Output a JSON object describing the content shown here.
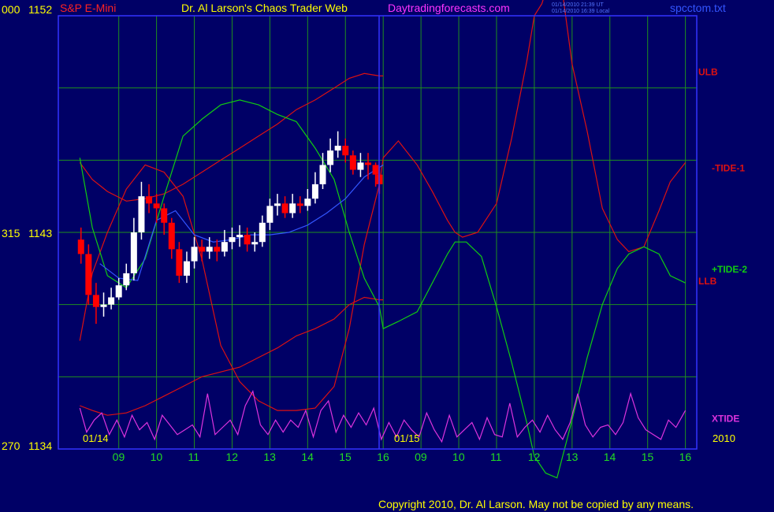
{
  "header": {
    "left_label": "000",
    "instrument": "S&P E-Mini",
    "title": "Dr. Al Larson's Chaos Trader Web",
    "site": "Daytradingforecasts.com",
    "timestamp_ut": "01/14/2010 21:39 UT",
    "timestamp_local": "01/14/2010 16:39 Local",
    "filename": "spcctom.txt"
  },
  "footer": {
    "copyright": "Copyright 2010, Dr. Al Larson. May not be copied by any means."
  },
  "chart_data": {
    "type": "line",
    "title": "S&P E-Mini",
    "ylim": [
      1134,
      1152
    ],
    "y_axis_left": [
      {
        "prefix": "000",
        "value": "1152"
      },
      {
        "prefix": "315",
        "value": "1143"
      },
      {
        "prefix": "270",
        "value": "1134"
      }
    ],
    "x_ticks": [
      "09",
      "10",
      "11",
      "12",
      "13",
      "14",
      "15",
      "16",
      "09",
      "10",
      "11",
      "12",
      "13",
      "14",
      "15",
      "16"
    ],
    "date_labels": [
      "01/14",
      "01/15"
    ],
    "year_label": "2010",
    "grid": true,
    "colors": {
      "background": "#000066",
      "grid": "#1f8f1f",
      "frame": "#3333ff",
      "ulb_llb": "#dd1111",
      "tide1": "#dd1111",
      "tide2": "#11cc11",
      "xtide": "#dd33dd",
      "price_up": "#ffffff",
      "price_down": "#ff0000",
      "avg": "#3355ff"
    },
    "series": [
      {
        "name": "ULB",
        "color": "#dd1111",
        "label_y": 1149.7,
        "x": [
          7.97,
          8.3,
          8.7,
          9.2,
          9.7,
          10.2,
          10.7,
          11.2,
          11.7,
          12.2,
          12.7,
          13.2,
          13.7,
          14.2,
          14.7,
          15.1,
          15.5,
          15.9,
          16.0
        ],
        "y": [
          1145.9,
          1145.2,
          1144.7,
          1144.3,
          1144.4,
          1144.6,
          1145.0,
          1145.5,
          1146.0,
          1146.5,
          1147.0,
          1147.5,
          1148.1,
          1148.5,
          1149.0,
          1149.4,
          1149.6,
          1149.5,
          1149.5
        ]
      },
      {
        "name": "LLB",
        "color": "#dd1111",
        "label_y": 1141.0,
        "x": [
          7.97,
          8.3,
          8.7,
          9.2,
          9.7,
          10.2,
          10.7,
          11.2,
          11.7,
          12.2,
          12.7,
          13.2,
          13.7,
          14.2,
          14.7,
          15.1,
          15.5,
          15.9,
          16.0
        ],
        "y": [
          1135.8,
          1135.6,
          1135.4,
          1135.5,
          1135.8,
          1136.2,
          1136.6,
          1137.0,
          1137.2,
          1137.4,
          1137.8,
          1138.2,
          1138.7,
          1139.0,
          1139.4,
          1140.0,
          1140.3,
          1140.2,
          1140.2
        ]
      },
      {
        "name": "-TIDE-1",
        "color": "#dd1111",
        "label_y": 1145.7,
        "x": [
          7.97,
          8.3,
          8.7,
          9.2,
          9.7,
          10.2,
          10.7,
          11.2,
          11.7,
          12.2,
          12.7,
          13.2,
          13.7,
          14.2,
          14.7,
          15.1,
          15.5,
          15.9,
          16.0,
          16.4,
          16.9,
          17.3,
          17.7,
          17.9,
          18.1,
          18.5,
          19.0,
          19.4,
          19.8,
          20.0,
          20.2,
          20.4,
          20.55,
          20.7,
          21.0,
          21.4,
          21.8,
          22.2,
          22.5,
          22.9,
          23.3,
          23.6,
          24.0
        ],
        "y": [
          1138.5,
          1141.3,
          1143.0,
          1144.8,
          1145.8,
          1145.5,
          1144.5,
          1141.9,
          1138.3,
          1136.8,
          1136.0,
          1135.6,
          1135.6,
          1135.7,
          1136.6,
          1139.0,
          1142.5,
          1145.0,
          1146.1,
          1146.8,
          1145.8,
          1144.7,
          1143.5,
          1143.0,
          1142.8,
          1143.0,
          1144.2,
          1146.9,
          1150.1,
          1152.0,
          1152.5,
          1153.5,
          1154.6,
          1153.5,
          1150.0,
          1147.2,
          1144.0,
          1142.7,
          1142.2,
          1142.4,
          1143.9,
          1145.1,
          1145.9
        ]
      },
      {
        "name": "+TIDE-2",
        "color": "#11cc11",
        "label_y": 1141.5,
        "x": [
          7.97,
          8.3,
          8.7,
          9.2,
          9.7,
          10.2,
          10.7,
          11.2,
          11.7,
          12.2,
          12.7,
          13.2,
          13.7,
          14.2,
          14.7,
          15.1,
          15.5,
          15.9,
          16.0,
          16.4,
          16.9,
          17.3,
          17.7,
          17.9,
          18.2,
          18.6,
          19.0,
          19.4,
          19.8,
          20.0,
          20.3,
          20.6,
          20.7,
          21.0,
          21.4,
          21.8,
          22.2,
          22.5,
          22.9,
          23.3,
          23.6,
          24.0
        ],
        "y": [
          1146.1,
          1143.2,
          1141.2,
          1140.7,
          1141.9,
          1144.5,
          1147.0,
          1147.7,
          1148.3,
          1148.5,
          1148.3,
          1147.9,
          1147.6,
          1146.5,
          1145.2,
          1143.0,
          1141.1,
          1139.9,
          1139.0,
          1139.3,
          1139.7,
          1140.9,
          1142.1,
          1142.6,
          1142.6,
          1142.0,
          1139.9,
          1137.6,
          1135.1,
          1133.7,
          1133.0,
          1132.8,
          1133.4,
          1135.2,
          1137.8,
          1140.0,
          1141.5,
          1142.1,
          1142.4,
          1142.1,
          1141.2,
          1140.9
        ]
      },
      {
        "name": "XTIDE",
        "color": "#dd33dd",
        "label_y": 1135.3,
        "x": [
          7.97,
          8.15,
          8.35,
          8.55,
          8.75,
          8.95,
          9.15,
          9.35,
          9.55,
          9.75,
          9.95,
          10.15,
          10.35,
          10.55,
          10.75,
          10.95,
          11.15,
          11.35,
          11.55,
          11.75,
          11.95,
          12.15,
          12.35,
          12.55,
          12.75,
          12.95,
          13.15,
          13.35,
          13.55,
          13.75,
          13.95,
          14.15,
          14.35,
          14.55,
          14.75,
          14.95,
          15.15,
          15.35,
          15.55,
          15.75,
          15.95,
          16.15,
          16.35,
          16.55,
          16.75,
          16.95,
          17.15,
          17.35,
          17.55,
          17.75,
          17.95,
          18.15,
          18.35,
          18.55,
          18.75,
          18.95,
          19.15,
          19.35,
          19.55,
          19.75,
          19.95,
          20.15,
          20.35,
          20.55,
          20.75,
          20.95,
          21.15,
          21.35,
          21.55,
          21.75,
          21.95,
          22.15,
          22.35,
          22.55,
          22.75,
          22.95,
          23.15,
          23.35,
          23.55,
          23.75,
          24.0
        ],
        "y": [
          1135.7,
          1134.7,
          1135.2,
          1135.5,
          1134.6,
          1135.2,
          1134.5,
          1135.4,
          1134.8,
          1135.1,
          1134.4,
          1135.4,
          1135.0,
          1134.6,
          1134.8,
          1135.0,
          1134.5,
          1136.3,
          1134.6,
          1134.9,
          1135.2,
          1134.6,
          1135.8,
          1136.4,
          1135.0,
          1134.6,
          1135.2,
          1134.7,
          1135.2,
          1134.9,
          1135.6,
          1134.5,
          1135.6,
          1136.0,
          1134.7,
          1135.4,
          1134.9,
          1135.5,
          1135.0,
          1135.7,
          1134.4,
          1135.1,
          1134.5,
          1135.2,
          1134.8,
          1134.5,
          1135.5,
          1134.8,
          1134.3,
          1135.4,
          1134.5,
          1134.8,
          1135.1,
          1134.4,
          1135.3,
          1134.6,
          1134.5,
          1135.9,
          1134.5,
          1134.9,
          1135.2,
          1134.7,
          1135.4,
          1134.8,
          1134.4,
          1135.1,
          1136.3,
          1135.0,
          1134.5,
          1134.9,
          1135.0,
          1134.6,
          1135.1,
          1136.3,
          1135.3,
          1134.8,
          1134.6,
          1134.4,
          1135.2,
          1134.9,
          1135.6
        ]
      },
      {
        "name": "avg",
        "color": "#3355ff",
        "x": [
          8.5,
          9.0,
          9.5,
          10.0,
          10.5,
          11.0,
          11.5,
          12.0,
          12.5,
          13.0,
          13.5,
          14.0,
          14.5,
          15.0,
          15.5,
          16.0
        ],
        "y": [
          1141.7,
          1141.1,
          1141.0,
          1143.5,
          1143.9,
          1142.9,
          1142.6,
          1142.7,
          1142.9,
          1142.9,
          1143.0,
          1143.3,
          1143.8,
          1144.4,
          1145.3,
          1145.8
        ]
      }
    ],
    "price": {
      "x": [
        8.0,
        8.2,
        8.4,
        8.6,
        8.8,
        9.0,
        9.2,
        9.4,
        9.6,
        9.8,
        10.0,
        10.2,
        10.4,
        10.6,
        10.8,
        11.0,
        11.2,
        11.4,
        11.6,
        11.8,
        12.0,
        12.2,
        12.4,
        12.6,
        12.8,
        13.0,
        13.2,
        13.4,
        13.6,
        13.8,
        14.0,
        14.2,
        14.4,
        14.6,
        14.8,
        15.0,
        15.2,
        15.4,
        15.6,
        15.8,
        15.9
      ],
      "open": [
        1142.7,
        1142.1,
        1140.4,
        1139.9,
        1140.0,
        1140.3,
        1140.8,
        1141.3,
        1143.0,
        1144.5,
        1144.2,
        1144.0,
        1143.4,
        1142.3,
        1141.2,
        1141.8,
        1142.4,
        1142.2,
        1142.4,
        1142.2,
        1142.6,
        1142.8,
        1142.9,
        1142.5,
        1142.6,
        1143.4,
        1144.1,
        1144.2,
        1143.8,
        1144.2,
        1144.1,
        1144.4,
        1145.0,
        1145.8,
        1146.4,
        1146.6,
        1146.2,
        1145.6,
        1145.9,
        1145.8,
        1145.4
      ],
      "close": [
        1142.1,
        1140.4,
        1139.9,
        1140.0,
        1140.3,
        1140.8,
        1141.3,
        1143.0,
        1144.5,
        1144.2,
        1144.0,
        1143.4,
        1142.3,
        1141.2,
        1141.8,
        1142.4,
        1142.2,
        1142.4,
        1142.2,
        1142.6,
        1142.8,
        1142.9,
        1142.5,
        1142.6,
        1143.4,
        1144.1,
        1144.2,
        1143.8,
        1144.2,
        1144.1,
        1144.4,
        1145.0,
        1145.8,
        1146.4,
        1146.6,
        1146.2,
        1145.6,
        1145.9,
        1145.8,
        1145.4,
        1145.0
      ],
      "high": [
        1143.2,
        1142.5,
        1140.9,
        1140.5,
        1140.7,
        1141.1,
        1141.7,
        1143.6,
        1145.1,
        1145.0,
        1144.6,
        1144.2,
        1143.6,
        1142.6,
        1142.2,
        1142.8,
        1142.7,
        1142.8,
        1142.7,
        1143.1,
        1143.2,
        1143.3,
        1143.2,
        1143.0,
        1143.7,
        1144.4,
        1144.6,
        1144.5,
        1144.6,
        1144.5,
        1144.8,
        1145.5,
        1146.3,
        1146.9,
        1147.2,
        1146.9,
        1146.4,
        1146.3,
        1146.3,
        1145.9,
        1145.7
      ],
      "low": [
        1141.7,
        1140.0,
        1139.2,
        1139.5,
        1139.8,
        1140.2,
        1140.6,
        1141.0,
        1142.7,
        1143.8,
        1143.4,
        1142.9,
        1141.9,
        1140.9,
        1140.9,
        1141.5,
        1141.8,
        1141.9,
        1141.8,
        1142.0,
        1142.3,
        1142.4,
        1142.2,
        1142.2,
        1142.4,
        1143.1,
        1143.7,
        1143.6,
        1143.6,
        1143.8,
        1143.9,
        1144.2,
        1144.8,
        1145.5,
        1146.1,
        1145.9,
        1145.4,
        1145.3,
        1145.2,
        1144.9,
        1144.6
      ]
    }
  }
}
